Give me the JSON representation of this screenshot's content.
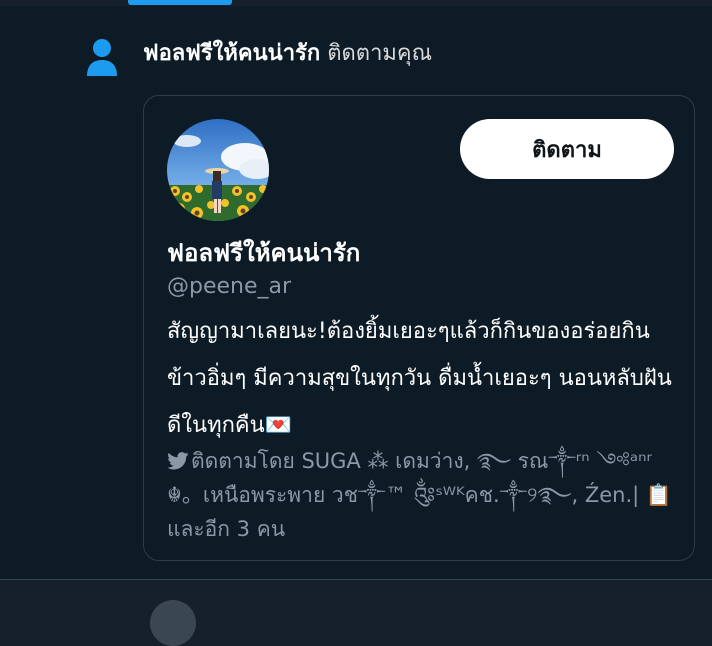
{
  "notification": {
    "name": "ฟอลฟรีให้คนน่ารัก",
    "action": "ติดตามคุณ"
  },
  "card": {
    "follow_label": "ติดตาม",
    "display_name": "ฟอลฟรีให้คนน่ารัก",
    "handle": "@peene_ar",
    "bio": "สัญญามาเลยนะ!ต้องยิ้มเยอะๆแล้วก็กินของอร่อยกินข้าวอิ่มๆ มีความสุขในทุกวัน ดื่มน้ำเยอะๆ นอนหลับฝันดีในทุกคืน",
    "bio_emoji": "💌",
    "followed_by": "ติดตามโดย SUGA ⁂ เดมว่าง, ࿐ รณ༒ʳⁿ ༺ᵃⁿʳ ☬。เหนือพระพาย วช༒™ ༂ˢᵂᴷคช.༒୨࿐, Źen.| 📋 และอีก 3 คน"
  },
  "colors": {
    "accent": "#1d9bf0",
    "background": "#0d1b26",
    "secondary_text": "#8b98a5"
  }
}
